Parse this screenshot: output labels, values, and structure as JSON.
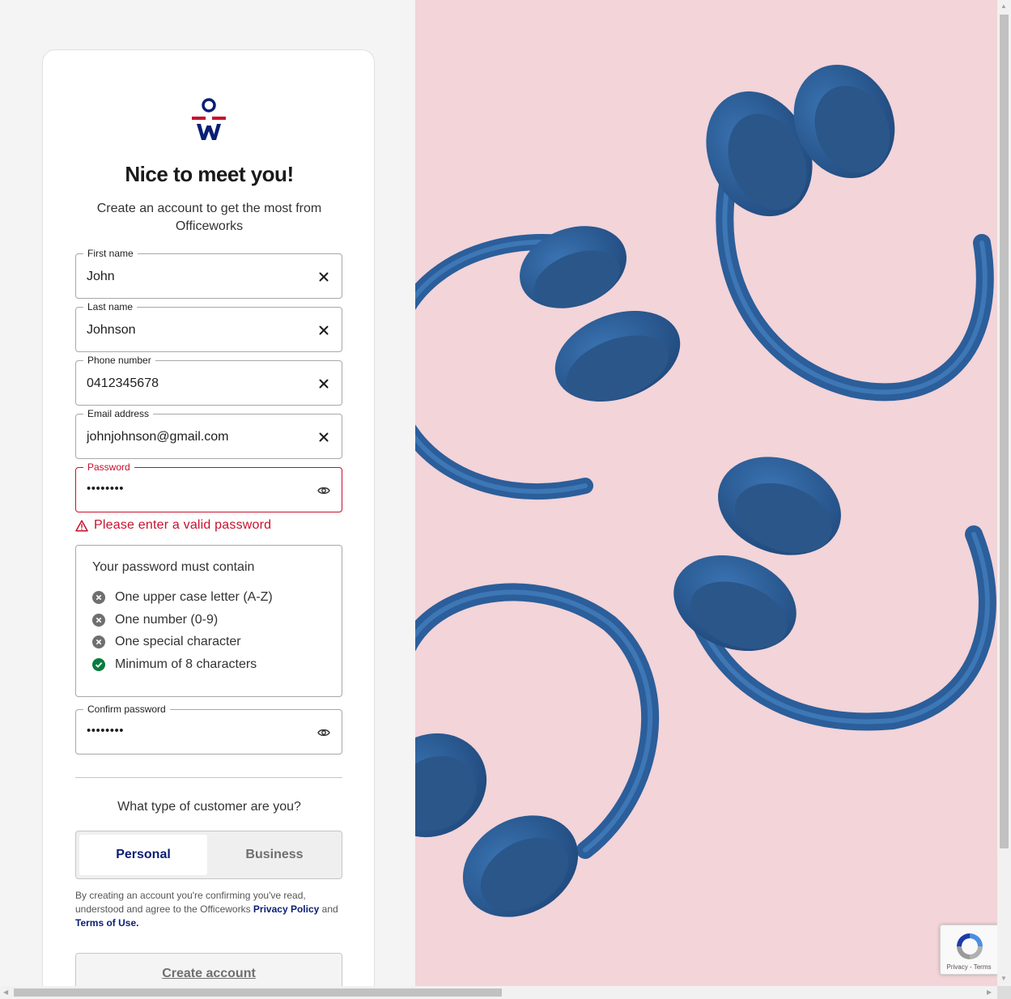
{
  "heading": "Nice to meet you!",
  "subtitle": "Create an account to get the most from Officeworks",
  "fields": {
    "first_name": {
      "label": "First name",
      "value": "John"
    },
    "last_name": {
      "label": "Last name",
      "value": "Johnson"
    },
    "phone": {
      "label": "Phone number",
      "value": "0412345678"
    },
    "email": {
      "label": "Email address",
      "value": "johnjohnson@gmail.com"
    },
    "password": {
      "label": "Password",
      "value": "••••••••"
    },
    "confirm_password": {
      "label": "Confirm password",
      "value": "••••••••"
    }
  },
  "password_error": "Please enter a valid password",
  "password_rules": {
    "title": "Your password must contain",
    "items": [
      {
        "label": "One upper case letter (A-Z)",
        "met": false
      },
      {
        "label": "One number (0-9)",
        "met": false
      },
      {
        "label": "One special character",
        "met": false
      },
      {
        "label": "Minimum of 8 characters",
        "met": true
      }
    ]
  },
  "customer_type": {
    "question": "What type of customer are you?",
    "options": [
      "Personal",
      "Business"
    ],
    "selected": "Personal"
  },
  "terms": {
    "prefix": "By creating an account you're confirming you've read, understood and agree to the Officeworks ",
    "privacy_link": "Privacy Policy",
    "middle": " and ",
    "terms_link": "Terms of Use."
  },
  "create_account_label": "Create account",
  "recaptcha": {
    "links": "Privacy - Terms"
  },
  "colors": {
    "brand_navy": "#0a1e73",
    "brand_red": "#c8102e",
    "success_green": "#0a7c3e",
    "hero_pink": "#f2d4d9",
    "headphone_blue": "#2b5e9a"
  },
  "icons": {
    "clear": "close-icon",
    "reveal": "eye-icon",
    "error": "warning-triangle-icon",
    "rule_unmet": "x-circle-icon",
    "rule_met": "check-circle-icon"
  }
}
